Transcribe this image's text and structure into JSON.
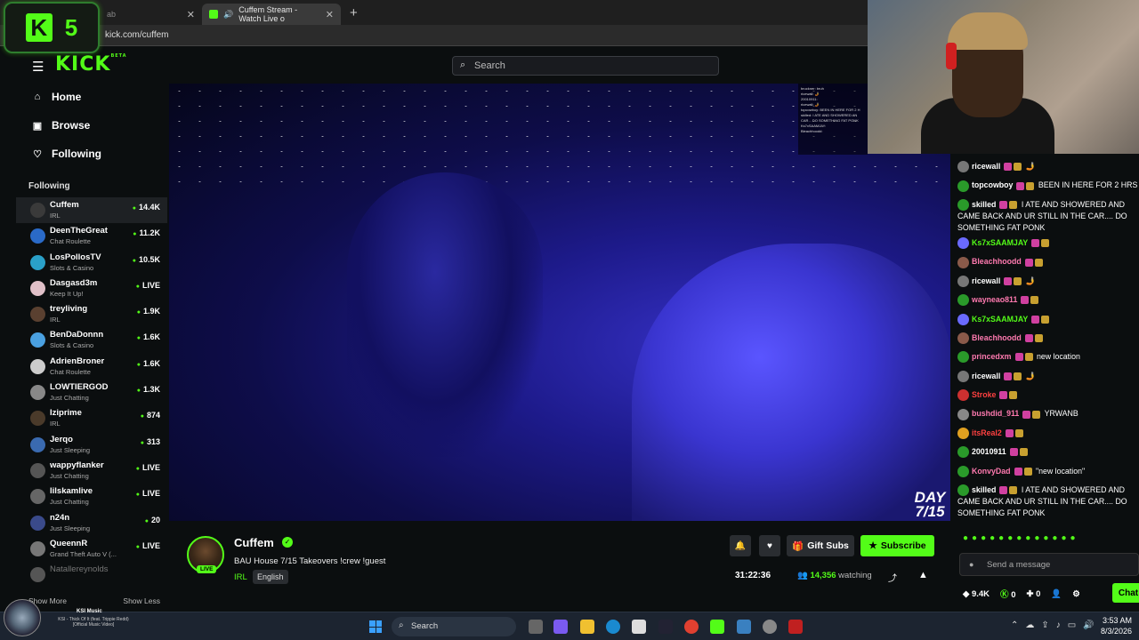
{
  "browser": {
    "tabs": [
      {
        "label": "ab",
        "active": false
      },
      {
        "label": "Cuffem Stream - Watch Live o",
        "active": true
      }
    ],
    "url": "kick.com/cuffem"
  },
  "overlay_logo": {
    "left": "K",
    "right": "5"
  },
  "header": {
    "logo": "KICK",
    "logo_sup": "BETA",
    "search_placeholder": "Search"
  },
  "nav": {
    "home": "Home",
    "browse": "Browse",
    "following": "Following"
  },
  "sidebar": {
    "following_heading": "Following",
    "channels": [
      {
        "name": "Cuffem",
        "category": "IRL",
        "viewers": "14.4K",
        "color": "#3a3a3a"
      },
      {
        "name": "DeenTheGreat",
        "category": "Chat Roulette",
        "viewers": "11.2K",
        "color": "#2a6ac8"
      },
      {
        "name": "LosPollosTV",
        "category": "Slots & Casino",
        "viewers": "10.5K",
        "color": "#2aa0c8"
      },
      {
        "name": "Dasgasd3m",
        "category": "Keep It Up!",
        "viewers": "LIVE",
        "color": "#e0c0c8"
      },
      {
        "name": "treyliving",
        "category": "IRL",
        "viewers": "1.9K",
        "color": "#5a4030"
      },
      {
        "name": "BenDaDonnn",
        "category": "Slots & Casino",
        "viewers": "1.6K",
        "color": "#4aa0e0"
      },
      {
        "name": "AdrienBroner",
        "category": "Chat Roulette",
        "viewers": "1.6K",
        "color": "#ccc"
      },
      {
        "name": "LOWTIERGOD",
        "category": "Just Chatting",
        "viewers": "1.3K",
        "color": "#888"
      },
      {
        "name": "Iziprime",
        "category": "IRL",
        "viewers": "874",
        "color": "#4a3a2a"
      },
      {
        "name": "Jerqo",
        "category": "Just Sleeping",
        "viewers": "313",
        "color": "#3a6ab0"
      },
      {
        "name": "wappyflanker",
        "category": "Just Chatting",
        "viewers": "LIVE",
        "color": "#555"
      },
      {
        "name": "lilskamlive",
        "category": "Just Chatting",
        "viewers": "LIVE",
        "color": "#666"
      },
      {
        "name": "n24n",
        "category": "Just Sleeping",
        "viewers": "20",
        "color": "#3a4a8a"
      },
      {
        "name": "QueennR",
        "category": "Grand Theft Auto V (...",
        "viewers": "LIVE",
        "color": "#777"
      },
      {
        "name": "Natallereynolds",
        "category": "",
        "viewers": "",
        "color": "#555",
        "offline": true
      }
    ],
    "show_more": "Show More",
    "show_less": "Show Less"
  },
  "media": {
    "title": "KSI Music",
    "subtitle": "KSI - Thick Of It (feat. Trippie Redd) [Official Music Video]"
  },
  "video": {
    "day_label": "DAY",
    "day_value": "7/15"
  },
  "minichat_lines": [
    "bruckner: bruh",
    "ricewall: 🤳",
    "20010911:",
    "ricewall: 🤳",
    "topcowboy: BEEN IN HERE FOR 2 H",
    "skilled: I ATE AND SHOWERED AN",
    "CAR... DO SOMETHING FAT PONK",
    "Ks7xSAAMJAY:",
    "Bleachhoodd:"
  ],
  "stream": {
    "name": "Cuffem",
    "live_badge": "LIVE",
    "title": "BAU House 7/15 Takeovers !crew !guest",
    "category": "IRL",
    "language": "English",
    "gift_subs": "Gift Subs",
    "subscribe": "Subscribe",
    "uptime": "31:22:36",
    "viewer_count": "14,356",
    "viewer_suffix": "watching"
  },
  "chat": {
    "messages": [
      {
        "user": "ricewall",
        "color": "#ffffff",
        "text": "🤳",
        "avatar": "#777"
      },
      {
        "user": "topcowboy",
        "color": "#ffffff",
        "text": "BEEN IN HERE FOR 2 HRS",
        "avatar": "#2a9a2a"
      },
      {
        "user": "skilled",
        "color": "#ffffff",
        "text": "I ATE AND SHOWERED AND CAME BACK AND UR STILL IN THE CAR.... DO SOMETHING FAT PONK",
        "avatar": "#2a9a2a"
      },
      {
        "user": "Ks7xSAAMJAY",
        "color": "#53fc18",
        "text": "",
        "avatar": "#6a6aff"
      },
      {
        "user": "Bleachhoodd",
        "color": "#ff7ab0",
        "text": "",
        "avatar": "#8a5a4a"
      },
      {
        "user": "ricewall",
        "color": "#ffffff",
        "text": "🤳",
        "avatar": "#777"
      },
      {
        "user": "wayneao811",
        "color": "#ff7ab0",
        "text": "",
        "avatar": "#2a9a2a"
      },
      {
        "user": "Ks7xSAAMJAY",
        "color": "#53fc18",
        "text": "",
        "avatar": "#6a6aff"
      },
      {
        "user": "Bleachhoodd",
        "color": "#ff7ab0",
        "text": "",
        "avatar": "#8a5a4a"
      },
      {
        "user": "princedxm",
        "color": "#ff7ab0",
        "text": "new location",
        "avatar": "#2a9a2a"
      },
      {
        "user": "ricewall",
        "color": "#ffffff",
        "text": "🤳",
        "avatar": "#777"
      },
      {
        "user": "Stroke",
        "color": "#ff4040",
        "text": "",
        "avatar": "#cc3030"
      },
      {
        "user": "bushdid_911",
        "color": "#ff7ab0",
        "text": "YRWANB",
        "avatar": "#888"
      },
      {
        "user": "itsReal2",
        "color": "#ff4040",
        "text": "",
        "avatar": "#e0a020"
      },
      {
        "user": "20010911",
        "color": "#ffffff",
        "text": "",
        "avatar": "#2a9a2a"
      },
      {
        "user": "KonvyDad",
        "color": "#ff7ab0",
        "text": "\"new location\"",
        "avatar": "#2a9a2a"
      },
      {
        "user": "skilled",
        "color": "#ffffff",
        "text": "I ATE AND SHOWERED AND CAME BACK AND UR STILL IN THE CAR.... DO SOMETHING FAT PONK",
        "avatar": "#2a9a2a"
      }
    ],
    "input_placeholder": "Send a message",
    "points": "9.4K",
    "kcoins": "0",
    "plus": "0",
    "chat_button": "Chat"
  },
  "taskbar": {
    "search_placeholder": "Search",
    "time": "3:53 AM",
    "date": "8/3/2026"
  }
}
